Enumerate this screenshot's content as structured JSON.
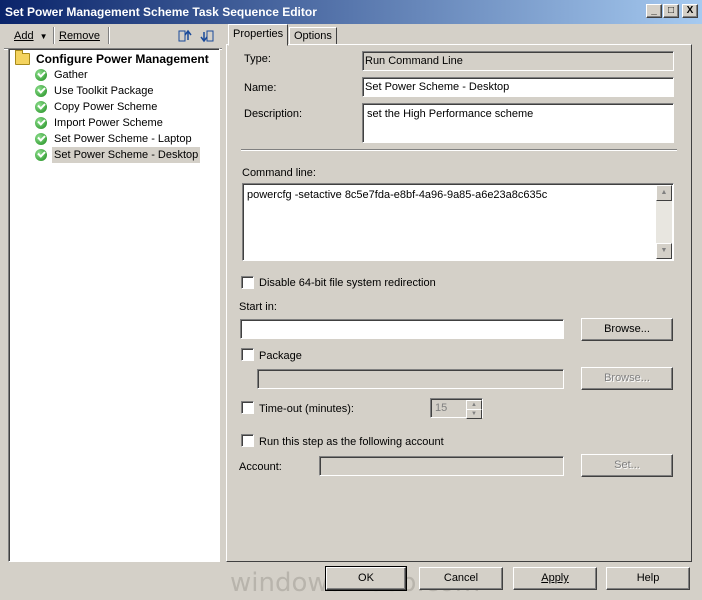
{
  "window": {
    "title": "Set Power Management Scheme Task Sequence Editor",
    "minimize": "_",
    "maximize": "□",
    "close": "X"
  },
  "toolbar": {
    "add_label": "Add",
    "remove_label": "Remove"
  },
  "tree": {
    "root": "Configure Power Management",
    "items": [
      {
        "label": "Gather"
      },
      {
        "label": "Use Toolkit Package"
      },
      {
        "label": "Copy Power Scheme"
      },
      {
        "label": "Import Power Scheme"
      },
      {
        "label": "Set Power Scheme - Laptop"
      },
      {
        "label": "Set Power Scheme - Desktop"
      }
    ],
    "selected_index": 5
  },
  "tabs": [
    {
      "label": "Properties",
      "active": true
    },
    {
      "label": "Options",
      "active": false
    }
  ],
  "properties": {
    "type_label": "Type:",
    "type_value": "Run Command Line",
    "name_label": "Name:",
    "name_value": "Set Power Scheme - Desktop",
    "description_label": "Description:",
    "description_value": "set the High Performance scheme",
    "command_line_label": "Command line:",
    "command_line_value": "powercfg -setactive 8c5e7fda-e8bf-4a96-9a85-a6e23a8c635c",
    "disable_redirection_label": "Disable 64-bit file system redirection",
    "start_in_label": "Start in:",
    "start_in_value": "",
    "browse_label": "Browse...",
    "package_label": "Package",
    "package_value": "",
    "browse_package_label": "Browse...",
    "timeout_label": "Time-out (minutes):",
    "timeout_value": "15",
    "run_as_label": "Run this step as the following account",
    "account_label": "Account:",
    "account_value": "",
    "set_label": "Set..."
  },
  "buttons": {
    "ok": "OK",
    "cancel": "Cancel",
    "apply": "Apply",
    "help": "Help"
  },
  "watermark": "windows-noob.com",
  "colors": {
    "titlebar_start": "#0a246a",
    "titlebar_end": "#a6caf0",
    "face": "#d4d0c8"
  }
}
